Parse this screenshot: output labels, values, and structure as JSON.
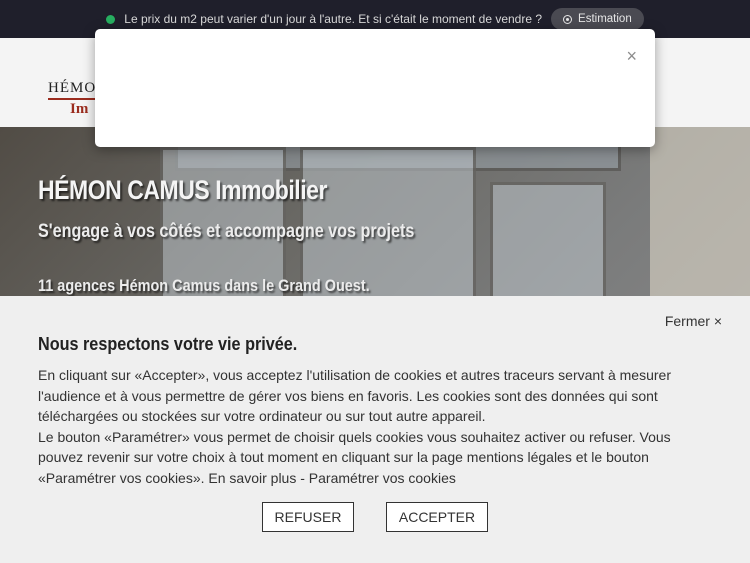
{
  "topbar": {
    "message": "Le prix du m2 peut varier d'un jour à l'autre. Et si c'était le moment de vendre ?",
    "estimation_label": "Estimation",
    "status_color": "#27ae60"
  },
  "header": {
    "logo_line1": "HÉMO",
    "logo_line2": "Im"
  },
  "hero": {
    "title": "HÉMON CAMUS Immobilier",
    "subtitle": "S'engage à vos côtés et accompagne vos projets",
    "agencies": "11 agences Hémon Camus dans le Grand Ouest."
  },
  "modal": {
    "close_label": "×"
  },
  "cookie": {
    "close_label": "Fermer ×",
    "title": "Nous respectons votre vie privée.",
    "paragraph1": "En cliquant sur «Accepter», vous acceptez l'utilisation de cookies et autres traceurs servant à mesurer l'audience et à vous permettre de gérer vos biens en favoris. Les cookies sont des données qui sont téléchargées ou stockées sur votre ordinateur ou sur tout autre appareil.",
    "paragraph2_start": "Le bouton «Paramétrer» vous permet de choisir quels cookies vous souhaitez activer ou refuser. Vous pouvez revenir sur votre choix à tout moment en cliquant sur la page mentions légales et le bouton «Paramétrer vos cookies». ",
    "learn_more": "En savoir plus",
    "separator": " - ",
    "settings_link": "Paramétrer vos cookies",
    "refuse_label": "REFUSER",
    "accept_label": "ACCEPTER"
  }
}
